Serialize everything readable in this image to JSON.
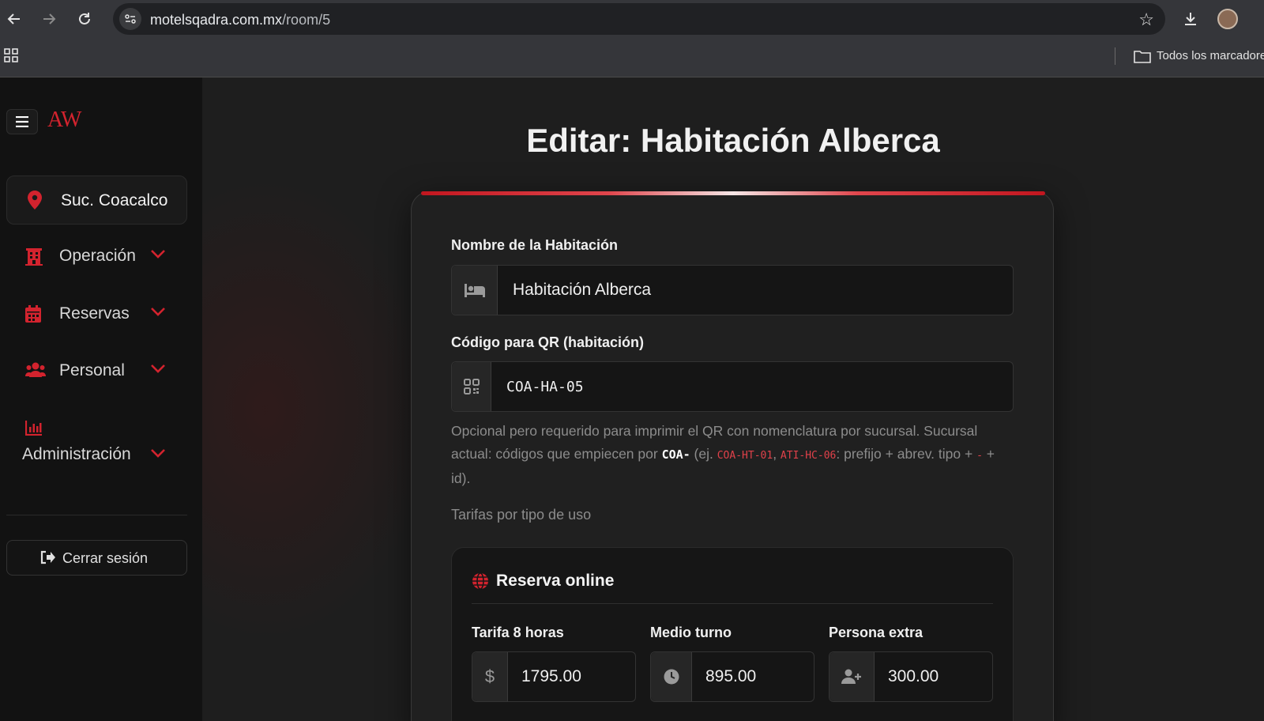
{
  "browser": {
    "url_domain": "motelsqadra.com.mx",
    "url_path": "/room/5",
    "bookmarks_label": "Todos los marcadores"
  },
  "sidebar": {
    "logo": "AW",
    "branch": "Suc. Coacalco",
    "items": [
      {
        "label": "Operación",
        "icon": "building-icon"
      },
      {
        "label": "Reservas",
        "icon": "calendar-icon"
      },
      {
        "label": "Personal",
        "icon": "users-icon"
      },
      {
        "label": "Administración",
        "icon": "chart-icon"
      }
    ],
    "logout": "Cerrar sesión"
  },
  "page": {
    "title": "Editar: Habitación Alberca"
  },
  "form": {
    "name_label": "Nombre de la Habitación",
    "name_value": "Habitación Alberca",
    "qr_label": "Código para QR (habitación)",
    "qr_value": "COA-HA-05",
    "help": {
      "t1": "Opcional pero requerido para imprimir el QR con nomenclatura por sucursal. Sucursal actual: códigos que empiecen por ",
      "prefix": "COA-",
      "t2": " (ej. ",
      "ex1": "COA-HT-01",
      "t3": ", ",
      "ex2": "ATI-HC-06",
      "t4": ": prefijo + abrev. tipo + ",
      "dash": "-",
      "t5": " + id)."
    },
    "rates_hint": "Tarifas por tipo de uso"
  },
  "online": {
    "title": "Reserva online",
    "rates": [
      {
        "label": "Tarifa 8 horas",
        "value": "1795.00",
        "icon": "dollar-icon"
      },
      {
        "label": "Medio turno",
        "value": "895.00",
        "icon": "clock-icon"
      },
      {
        "label": "Persona extra",
        "value": "300.00",
        "icon": "user-plus-icon"
      }
    ]
  },
  "colors": {
    "accent": "#d3232e",
    "background": "#1e1e1e",
    "sidebar": "#121212"
  }
}
